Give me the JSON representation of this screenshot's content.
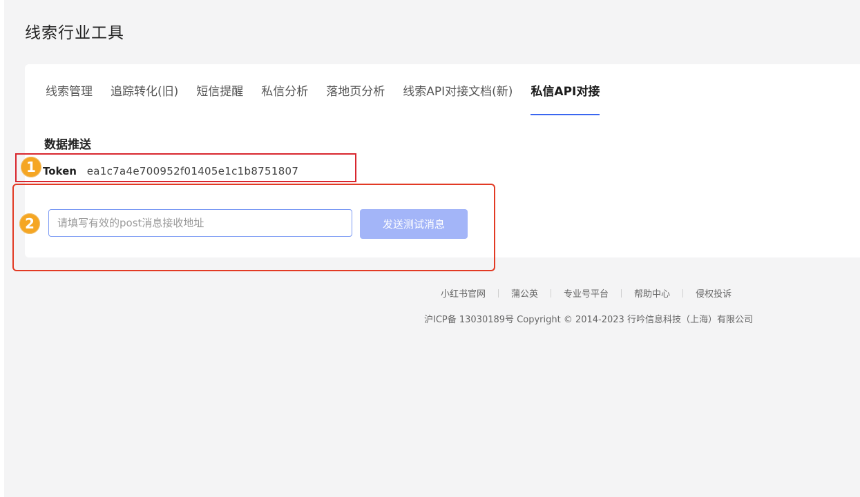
{
  "page": {
    "title": "线索行业工具"
  },
  "tabs": [
    {
      "label": "线索管理",
      "active": false
    },
    {
      "label": "追踪转化(旧)",
      "active": false
    },
    {
      "label": "短信提醒",
      "active": false
    },
    {
      "label": "私信分析",
      "active": false
    },
    {
      "label": "落地页分析",
      "active": false
    },
    {
      "label": "线索API对接文档(新)",
      "active": false
    },
    {
      "label": "私信API对接",
      "active": true
    }
  ],
  "push": {
    "section_title": "数据推送",
    "token_label": "Token",
    "token_value": "ea1c7a4e700952f01405e1c1b8751807",
    "url_placeholder": "请填写有效的post消息接收地址",
    "url_value": "",
    "send_button_label": "发送测试消息"
  },
  "annotations": {
    "badge_1": "1",
    "badge_2": "2",
    "badge_color": "#f5a623",
    "box_color": "#d8262e"
  },
  "footer": {
    "links": [
      "小红书官网",
      "蒲公英",
      "专业号平台",
      "帮助中心",
      "侵权投诉"
    ],
    "copyright": "沪ICP备 13030189号 Copyright © 2014-2023 行吟信息科技（上海）有限公司"
  },
  "colors": {
    "accent": "#3a66f0",
    "button_disabled": "#a3b5f8",
    "background": "#f4f4f5"
  }
}
